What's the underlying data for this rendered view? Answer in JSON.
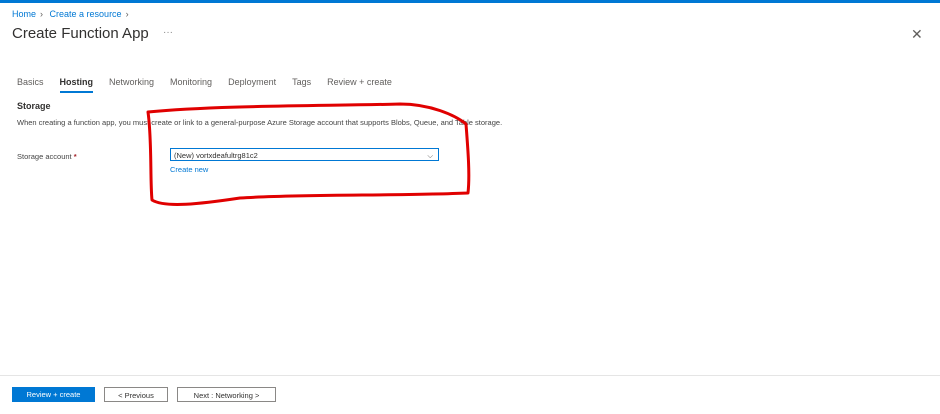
{
  "breadcrumb": [
    "Home",
    "Create a resource"
  ],
  "title": "Create Function App",
  "more": "···",
  "close": "✕",
  "tabs": [
    "Basics",
    "Hosting",
    "Networking",
    "Monitoring",
    "Deployment",
    "Tags",
    "Review + create"
  ],
  "active_tab": "Hosting",
  "section": {
    "heading": "Storage",
    "description": "When creating a function app, you must create or link to a general-purpose Azure Storage account that supports Blobs, Queue, and Table storage.",
    "field_label": "Storage account",
    "required": "*",
    "value": "(New) vortxdeafultrg81c2",
    "create_new": "Create new"
  },
  "footer": {
    "review": "Review + create",
    "previous": "< Previous",
    "next": "Next : Networking >"
  },
  "colors": {
    "accent": "#0078d4",
    "annotation": "#e00000"
  }
}
